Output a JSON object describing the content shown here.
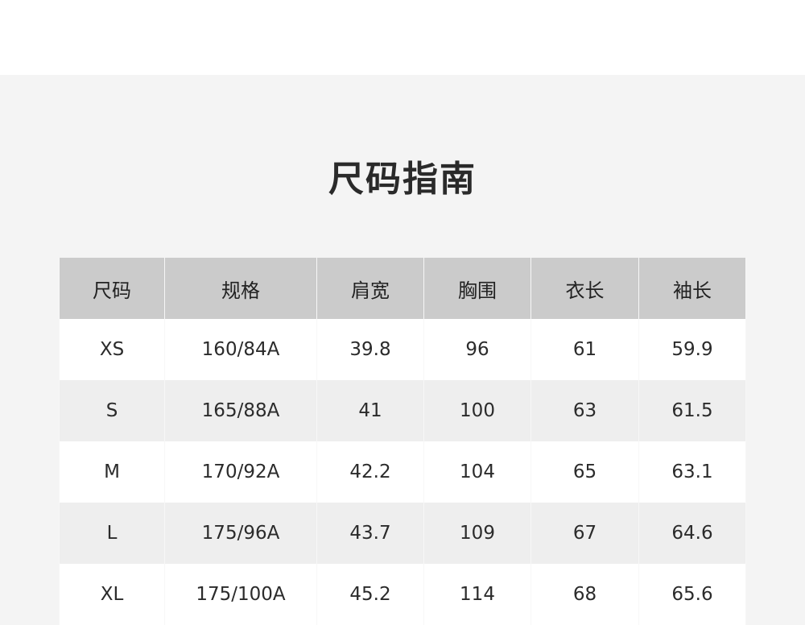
{
  "title": "尺码指南",
  "table": {
    "headers": [
      "尺码",
      "规格",
      "肩宽",
      "胸围",
      "衣长",
      "袖长"
    ],
    "rows": [
      [
        "XS",
        "160/84A",
        "39.8",
        "96",
        "61",
        "59.9"
      ],
      [
        "S",
        "165/88A",
        "41",
        "100",
        "63",
        "61.5"
      ],
      [
        "M",
        "170/92A",
        "42.2",
        "104",
        "65",
        "63.1"
      ],
      [
        "L",
        "175/96A",
        "43.7",
        "109",
        "67",
        "64.6"
      ],
      [
        "XL",
        "175/100A",
        "45.2",
        "114",
        "68",
        "65.6"
      ]
    ]
  }
}
